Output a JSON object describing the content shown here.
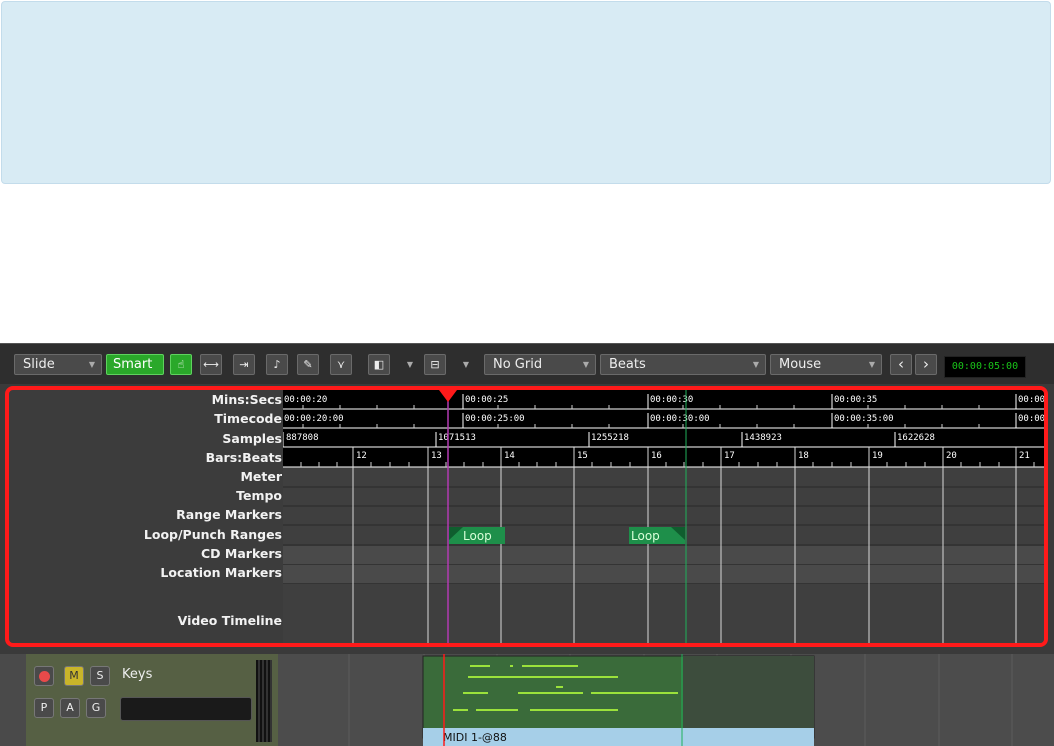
{
  "toolbar": {
    "edit_mode": "Slide",
    "smart": "Smart",
    "grid": "No Grid",
    "grid_type": "Beats",
    "edit_point": "Mouse",
    "nudge_clock": "00:00:05:00"
  },
  "rulers": {
    "labels": [
      "Mins:Secs",
      "Timecode",
      "Samples",
      "Bars:Beats",
      "Meter",
      "Tempo",
      "Range Markers",
      "Loop/Punch Ranges",
      "CD Markers",
      "Location Markers",
      "Video Timeline"
    ],
    "mins_secs": [
      "00:00:20",
      "00:00:25",
      "00:00:30",
      "00:00:35",
      "00:00:"
    ],
    "timecode": [
      "00:00:20:00",
      "00:00:25:00",
      "00:00:30:00",
      "00:00:35:00",
      "00:00:"
    ],
    "samples": [
      "887808",
      "1071513",
      "1255218",
      "1438923",
      "1622628"
    ],
    "bars": [
      "12",
      "13",
      "14",
      "15",
      "16",
      "17",
      "18",
      "19",
      "20",
      "21"
    ],
    "loop_start": "Loop",
    "loop_end": "Loop"
  },
  "track": {
    "name": "Keys",
    "mute": "M",
    "solo": "S",
    "p": "P",
    "a": "A",
    "g": "G",
    "region_name": "MIDI 1-@88"
  },
  "colors": {
    "highlight_border": "#ff1a1a",
    "banner": "#d8ebf4",
    "active_green": "#2aa82a",
    "clock_text": "#19c419",
    "playhead": "#ff1a1a",
    "region_label": "#a6cfe8"
  }
}
